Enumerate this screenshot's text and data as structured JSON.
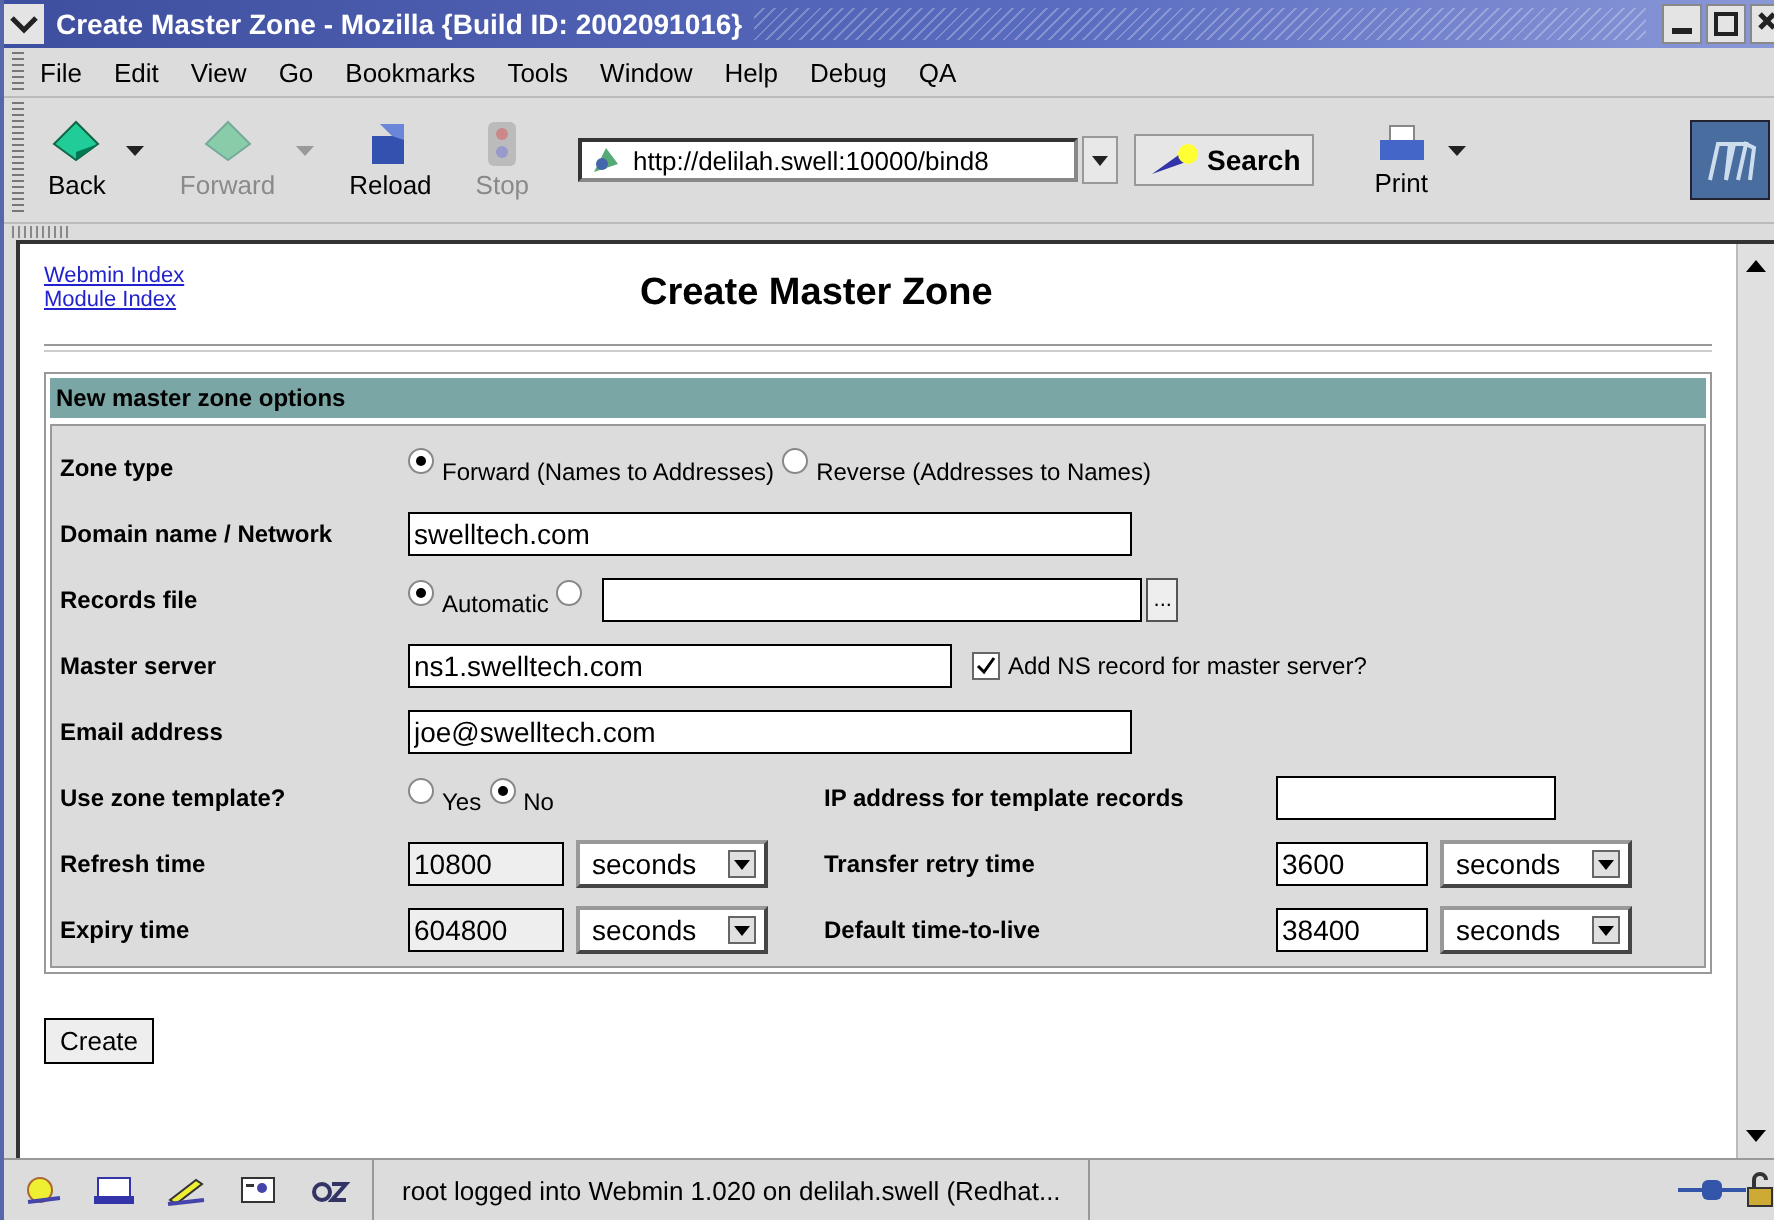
{
  "window": {
    "title": "Create Master Zone - Mozilla {Build ID: 2002091016}"
  },
  "menu": [
    "File",
    "Edit",
    "View",
    "Go",
    "Bookmarks",
    "Tools",
    "Window",
    "Help",
    "Debug",
    "QA"
  ],
  "toolbar": [
    {
      "kind": "back",
      "label": "Back",
      "disabled": false,
      "dropdown": true
    },
    {
      "kind": "forward",
      "label": "Forward",
      "disabled": true,
      "dropdown": true
    },
    {
      "kind": "reload",
      "label": "Reload",
      "disabled": false,
      "dropdown": false
    },
    {
      "kind": "stop",
      "label": "Stop",
      "disabled": true,
      "dropdown": false
    }
  ],
  "url": "http://delilah.swell:10000/bind8",
  "search_button": "Search",
  "print_button": "Print",
  "page": {
    "links": [
      "Webmin Index",
      "Module Index"
    ],
    "heading": "Create Master Zone",
    "section_title": "New master zone options",
    "rows": [
      {
        "kind": "radio",
        "label": "Zone type",
        "options": [
          {
            "label": "Forward (Names to Addresses)",
            "selected": true
          },
          {
            "label": "Reverse (Addresses to Names)",
            "selected": false
          }
        ]
      },
      {
        "kind": "text",
        "label": "Domain name / Network",
        "value": "swelltech.com"
      },
      {
        "kind": "file",
        "label": "Records file",
        "options": [
          {
            "label": "Automatic",
            "selected": true
          },
          {
            "selected": false
          }
        ],
        "browse": "..."
      },
      {
        "kind": "text_check",
        "label": "Master server",
        "value": "ns1.swelltech.com",
        "check_label": "Add NS record for master server?",
        "checked": true
      },
      {
        "kind": "text",
        "label": "Email address",
        "value": "joe@swelltech.com"
      },
      {
        "kind": "template",
        "label": "Use zone template?",
        "options": [
          {
            "label": "Yes",
            "selected": false
          },
          {
            "label": "No",
            "selected": true
          }
        ],
        "right_label": "IP address for template records"
      },
      {
        "kind": "times",
        "left": {
          "label": "Refresh time",
          "value": "10800",
          "unit": "seconds"
        },
        "right": {
          "label": "Transfer retry time",
          "value": "3600",
          "unit": "seconds"
        }
      },
      {
        "kind": "times",
        "left": {
          "label": "Expiry time",
          "value": "604800",
          "unit": "seconds"
        },
        "right": {
          "label": "Default time-to-live",
          "value": "38400",
          "unit": "seconds"
        }
      }
    ],
    "submit": "Create"
  },
  "status_bar": {
    "text": "root logged into Webmin 1.020 on delilah.swell (Redhat..."
  }
}
